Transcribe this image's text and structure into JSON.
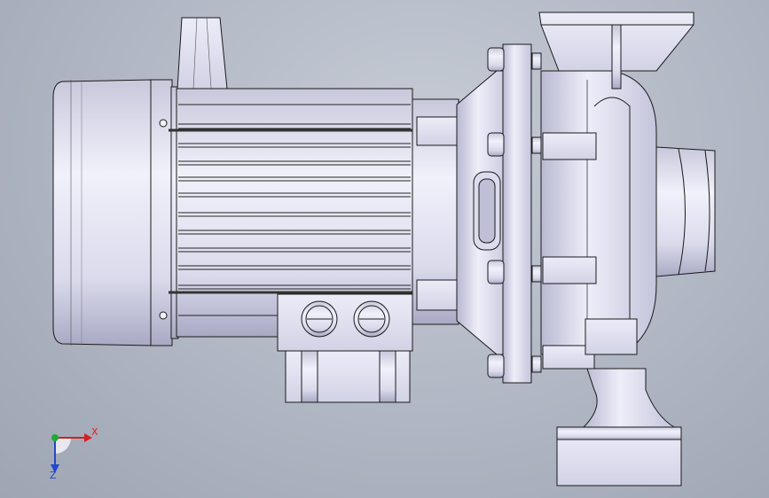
{
  "triad": {
    "x_label": "X",
    "z_label": "Z"
  },
  "colors": {
    "background": "#b4bac6",
    "part_fill": "#e4e4f4",
    "part_shade": "#b9b9d2",
    "edge": "#1a1a1a",
    "x_axis": "#d42020",
    "y_axis": "#1faa3a",
    "z_axis": "#2448c8"
  }
}
